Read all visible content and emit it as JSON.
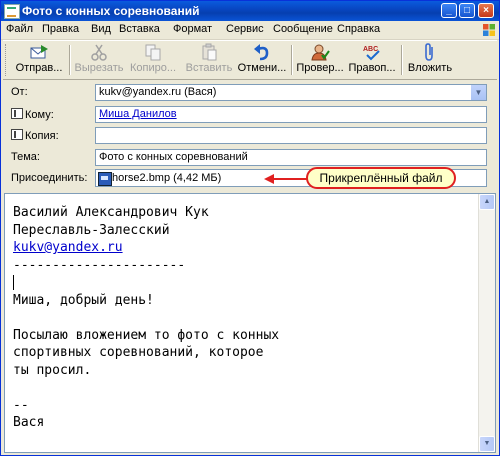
{
  "window": {
    "title": "Фото с конных соревнований"
  },
  "menu": [
    "Файл",
    "Правка",
    "Вид",
    "Вставка",
    "Формат",
    "Сервис",
    "Сообщение",
    "Справка"
  ],
  "toolbar": {
    "send": "Отправ...",
    "cut": "Вырезать",
    "copy": "Копиро...",
    "paste": "Вставить",
    "undo": "Отмени...",
    "check": "Провер...",
    "spell": "Правоп...",
    "attach": "Вложить"
  },
  "fields": {
    "from_label": "От:",
    "from_value": "kukv@yandex.ru   (Вася)",
    "to_label": "Кому:",
    "to_value": "Миша Данилов",
    "cc_label": "Копия:",
    "cc_value": "",
    "subject_label": "Тема:",
    "subject_value": "Фото с конных соревнований",
    "attach_label": "Присоединить:",
    "attach_value": "horse2.bmp (4,42 МБ)"
  },
  "callout": "Прикреплённый файл",
  "body": {
    "line1": "Василий Александрович Кук",
    "line2": "Переславль-Залесский",
    "email": "kukv@yandex.ru",
    "line4": "----------------------",
    "line5": "",
    "line6": "Миша, добрый день!",
    "line7": "",
    "line8": "Посылаю вложением то фото с конных",
    "line9": "спортивных соревнований, которое",
    "line10": "ты просил.",
    "line11": "",
    "line12": "--",
    "line13": "Вася"
  },
  "colors": {
    "titlebar": "#0A5BDD",
    "callout_border": "#E02020",
    "callout_bg": "#FFFFC8",
    "link": "#0000CC"
  },
  "icons": [
    "app-icon",
    "send-icon",
    "cut-icon",
    "copy-icon",
    "paste-icon",
    "undo-icon",
    "check-names-icon",
    "spelling-icon",
    "paperclip-icon",
    "address-book-icon",
    "bmp-file-icon"
  ]
}
